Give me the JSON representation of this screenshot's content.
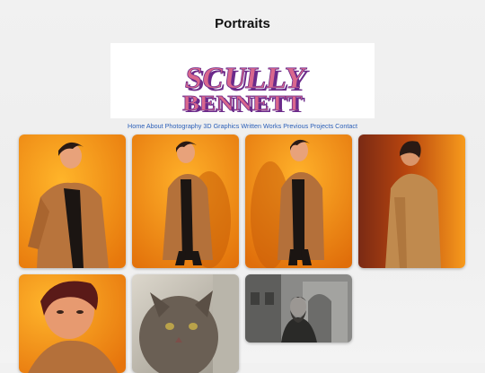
{
  "page": {
    "title": "Portraits"
  },
  "logo": {
    "line1": "SCULLY",
    "line2": "BENNETT"
  },
  "nav": {
    "items": [
      "Home",
      "About",
      "Photography",
      "3D Graphics",
      "Written Works",
      "Previous Projects",
      "Contact"
    ]
  },
  "gallery": {
    "photos": [
      {
        "subject": "person-in-trench-coat-orange-backdrop"
      },
      {
        "subject": "person-in-trench-coat-full-length"
      },
      {
        "subject": "person-in-trench-coat-hand-on-hip"
      },
      {
        "subject": "person-in-trench-coat-looking-back"
      },
      {
        "subject": "close-up-portrait-orange"
      },
      {
        "subject": "long-haired-cat"
      },
      {
        "subject": "bearded-man-monochrome-building"
      }
    ]
  },
  "colors": {
    "link": "#2b5fb8",
    "logo_pink": "#d9678d",
    "logo_purple": "#6b2a8a",
    "backdrop_orange": "#f59a1c"
  }
}
